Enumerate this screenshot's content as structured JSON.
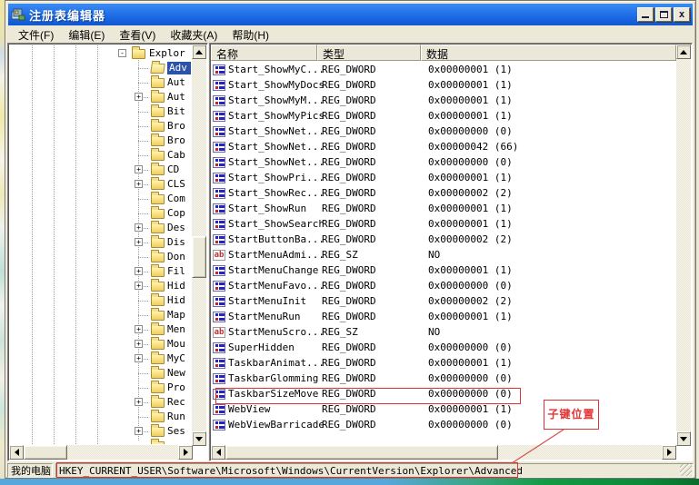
{
  "window": {
    "title": "注册表编辑器"
  },
  "menu": {
    "items": [
      {
        "label": "文件(F)"
      },
      {
        "label": "编辑(E)"
      },
      {
        "label": "查看(V)"
      },
      {
        "label": "收藏夹(A)"
      },
      {
        "label": "帮助(H)"
      }
    ]
  },
  "tree": {
    "items": [
      {
        "label": "Explor",
        "expand": "minus",
        "level": 0,
        "selected": false
      },
      {
        "label": "Adv",
        "expand": "none",
        "level": 1,
        "selected": true
      },
      {
        "label": "Aut",
        "expand": "none",
        "level": 1,
        "selected": false
      },
      {
        "label": "Aut",
        "expand": "plus",
        "level": 1,
        "selected": false
      },
      {
        "label": "Bit",
        "expand": "none",
        "level": 1,
        "selected": false
      },
      {
        "label": "Bro",
        "expand": "none",
        "level": 1,
        "selected": false
      },
      {
        "label": "Bro",
        "expand": "none",
        "level": 1,
        "selected": false
      },
      {
        "label": "Cab",
        "expand": "none",
        "level": 1,
        "selected": false
      },
      {
        "label": "CD",
        "expand": "plus",
        "level": 1,
        "selected": false
      },
      {
        "label": "CLS",
        "expand": "plus",
        "level": 1,
        "selected": false
      },
      {
        "label": "Com",
        "expand": "none",
        "level": 1,
        "selected": false
      },
      {
        "label": "Cop",
        "expand": "none",
        "level": 1,
        "selected": false
      },
      {
        "label": "Des",
        "expand": "plus",
        "level": 1,
        "selected": false
      },
      {
        "label": "Dis",
        "expand": "plus",
        "level": 1,
        "selected": false
      },
      {
        "label": "Don",
        "expand": "none",
        "level": 1,
        "selected": false
      },
      {
        "label": "Fil",
        "expand": "plus",
        "level": 1,
        "selected": false
      },
      {
        "label": "Hid",
        "expand": "plus",
        "level": 1,
        "selected": false
      },
      {
        "label": "Hid",
        "expand": "none",
        "level": 1,
        "selected": false
      },
      {
        "label": "Map",
        "expand": "none",
        "level": 1,
        "selected": false
      },
      {
        "label": "Men",
        "expand": "plus",
        "level": 1,
        "selected": false
      },
      {
        "label": "Mou",
        "expand": "plus",
        "level": 1,
        "selected": false
      },
      {
        "label": "MyC",
        "expand": "plus",
        "level": 1,
        "selected": false
      },
      {
        "label": "New",
        "expand": "none",
        "level": 1,
        "selected": false
      },
      {
        "label": "Pro",
        "expand": "none",
        "level": 1,
        "selected": false
      },
      {
        "label": "Rec",
        "expand": "plus",
        "level": 1,
        "selected": false
      },
      {
        "label": "Run",
        "expand": "none",
        "level": 1,
        "selected": false
      },
      {
        "label": "Ses",
        "expand": "plus",
        "level": 1,
        "selected": false
      },
      {
        "label": "",
        "expand": "none",
        "level": 1,
        "selected": false
      }
    ]
  },
  "table": {
    "columns": [
      "名称",
      "类型",
      "数据"
    ],
    "rows": [
      {
        "icon": "dword",
        "name": "Start_ShowMyC...",
        "type": "REG_DWORD",
        "data": "0x00000001 (1)",
        "highlighted": false
      },
      {
        "icon": "dword",
        "name": "Start_ShowMyDocs",
        "type": "REG_DWORD",
        "data": "0x00000001 (1)",
        "highlighted": false
      },
      {
        "icon": "dword",
        "name": "Start_ShowMyM...",
        "type": "REG_DWORD",
        "data": "0x00000001 (1)",
        "highlighted": false
      },
      {
        "icon": "dword",
        "name": "Start_ShowMyPics",
        "type": "REG_DWORD",
        "data": "0x00000001 (1)",
        "highlighted": false
      },
      {
        "icon": "dword",
        "name": "Start_ShowNet...",
        "type": "REG_DWORD",
        "data": "0x00000000 (0)",
        "highlighted": false
      },
      {
        "icon": "dword",
        "name": "Start_ShowNet...",
        "type": "REG_DWORD",
        "data": "0x00000042 (66)",
        "highlighted": false
      },
      {
        "icon": "dword",
        "name": "Start_ShowNet...",
        "type": "REG_DWORD",
        "data": "0x00000000 (0)",
        "highlighted": false
      },
      {
        "icon": "dword",
        "name": "Start_ShowPri...",
        "type": "REG_DWORD",
        "data": "0x00000001 (1)",
        "highlighted": false
      },
      {
        "icon": "dword",
        "name": "Start_ShowRec...",
        "type": "REG_DWORD",
        "data": "0x00000002 (2)",
        "highlighted": false
      },
      {
        "icon": "dword",
        "name": "Start_ShowRun",
        "type": "REG_DWORD",
        "data": "0x00000001 (1)",
        "highlighted": false
      },
      {
        "icon": "dword",
        "name": "Start_ShowSearch",
        "type": "REG_DWORD",
        "data": "0x00000001 (1)",
        "highlighted": false
      },
      {
        "icon": "dword",
        "name": "StartButtonBa...",
        "type": "REG_DWORD",
        "data": "0x00000002 (2)",
        "highlighted": false
      },
      {
        "icon": "sz",
        "name": "StartMenuAdmi...",
        "type": "REG_SZ",
        "data": "NO",
        "highlighted": false
      },
      {
        "icon": "dword",
        "name": "StartMenuChange",
        "type": "REG_DWORD",
        "data": "0x00000001 (1)",
        "highlighted": false
      },
      {
        "icon": "dword",
        "name": "StartMenuFavo...",
        "type": "REG_DWORD",
        "data": "0x00000000 (0)",
        "highlighted": false
      },
      {
        "icon": "dword",
        "name": "StartMenuInit",
        "type": "REG_DWORD",
        "data": "0x00000002 (2)",
        "highlighted": false
      },
      {
        "icon": "dword",
        "name": "StartMenuRun",
        "type": "REG_DWORD",
        "data": "0x00000001 (1)",
        "highlighted": false
      },
      {
        "icon": "sz",
        "name": "StartMenuScro...",
        "type": "REG_SZ",
        "data": "NO",
        "highlighted": false
      },
      {
        "icon": "dword",
        "name": "SuperHidden",
        "type": "REG_DWORD",
        "data": "0x00000000 (0)",
        "highlighted": false
      },
      {
        "icon": "dword",
        "name": "TaskbarAnimat...",
        "type": "REG_DWORD",
        "data": "0x00000001 (1)",
        "highlighted": false
      },
      {
        "icon": "dword",
        "name": "TaskbarGlomming",
        "type": "REG_DWORD",
        "data": "0x00000000 (0)",
        "highlighted": false
      },
      {
        "icon": "dword",
        "name": "TaskbarSizeMove",
        "type": "REG_DWORD",
        "data": "0x00000000 (0)",
        "highlighted": true
      },
      {
        "icon": "dword",
        "name": "WebView",
        "type": "REG_DWORD",
        "data": "0x00000001 (1)",
        "highlighted": false
      },
      {
        "icon": "dword",
        "name": "WebViewBarricade",
        "type": "REG_DWORD",
        "data": "0x00000000 (0)",
        "highlighted": false
      }
    ]
  },
  "status": {
    "computer": "我的电脑",
    "path": "HKEY_CURRENT_USER\\Software\\Microsoft\\Windows\\CurrentVersion\\Explorer\\Advanced"
  },
  "annotation": {
    "label": "子键位置"
  },
  "icons": {
    "sz_label": "ab"
  },
  "colors": {
    "titlebar_blue": "#1e6ce8",
    "selection_blue": "#2a52a8",
    "annotation_red": "#e03333"
  }
}
